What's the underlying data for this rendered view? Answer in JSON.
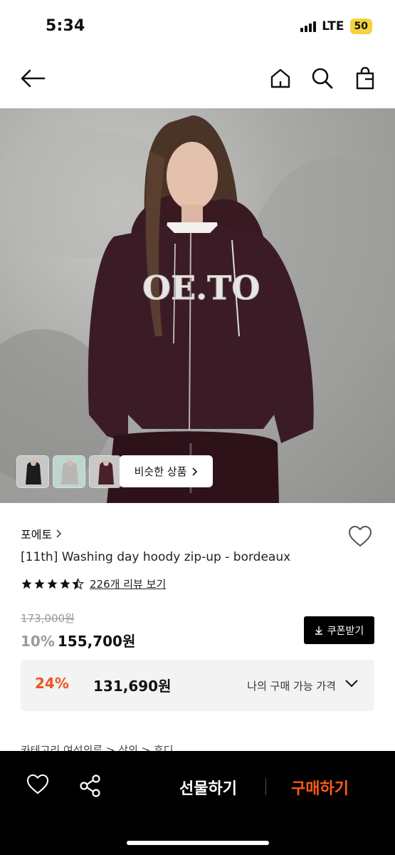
{
  "status": {
    "time": "5:34",
    "network": "LTE",
    "battery": "50"
  },
  "header": {
    "icons": {
      "back": "arrow-left-icon",
      "home": "home-icon",
      "search": "search-icon",
      "bag": "shopping-bag-icon"
    }
  },
  "gallery": {
    "similar_button": "비슷한 상품",
    "thumbnails": [
      {
        "icon": "thumbnail-1"
      },
      {
        "icon": "thumbnail-2"
      },
      {
        "icon": "thumbnail-3"
      }
    ]
  },
  "product": {
    "brand": "포에토",
    "name": "[11th] Washing day hoody zip-up - bordeaux",
    "rating": 4.5,
    "review_link": "226개 리뷰 보기",
    "original_price": "173,000원",
    "discount": "10%",
    "price": "155,700원",
    "coupon_button": "쿠폰받기"
  },
  "my_price": {
    "discount": "24%",
    "price": "131,690원",
    "label": "나의 구매 가능 가격"
  },
  "category_cut": "카테고리        여성의류 > 상의 > 후디",
  "bottom_bar": {
    "gift": "선물하기",
    "buy": "구매하기"
  },
  "colors": {
    "accent": "#ff5a1a",
    "discount_orange": "#f0531c",
    "battery": "#f5d33e"
  }
}
